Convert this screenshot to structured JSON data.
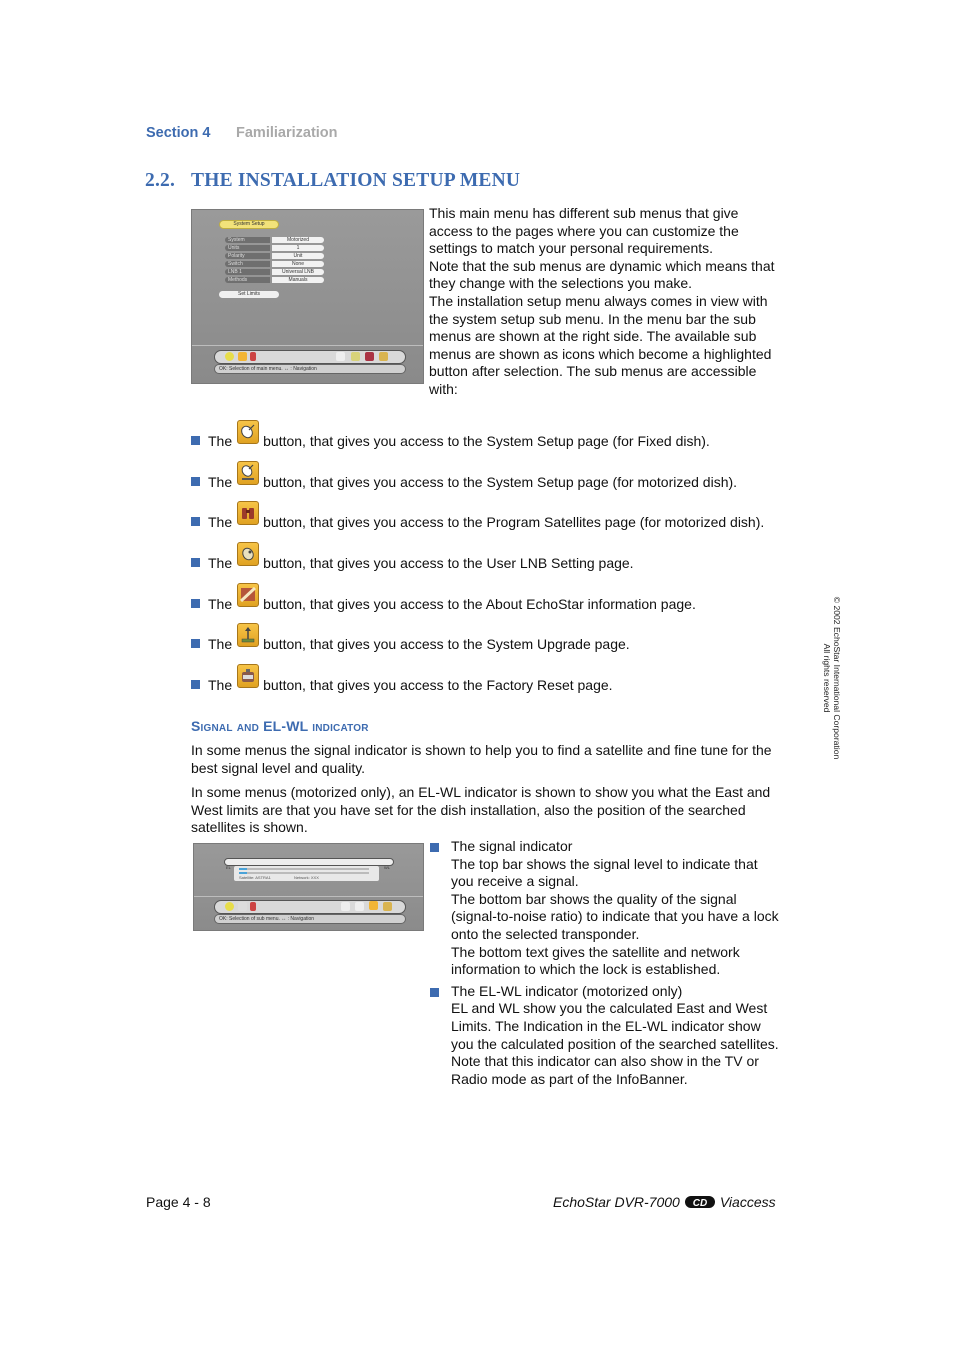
{
  "header": {
    "section_label": "Section 4",
    "section_name": "Familiarization"
  },
  "heading": {
    "number": "2.2.",
    "title": "THE INSTALLATION SETUP MENU"
  },
  "screenshot_setup": {
    "title": "System Setup",
    "rows": [
      {
        "label": "System",
        "value": "Motorized"
      },
      {
        "label": "Units",
        "value": "1"
      },
      {
        "label": "Polarity",
        "value": "Unit"
      },
      {
        "label": "Switch",
        "value": "None"
      },
      {
        "label": "LNB 1",
        "value": "Universal LNB"
      },
      {
        "label": "Methods",
        "value": "Manuals"
      }
    ],
    "button": "Set Limits",
    "status": "OK: Selection of main menu. ↔ : Navigation"
  },
  "intro": [
    "This main menu has different sub menus that give access to the pages where you can customize the settings to match your personal requirements.",
    "Note that the sub menus are dynamic which means that they change with the selections you make.",
    "The installation setup menu always comes in view with the system setup sub menu. In the menu bar the sub menus are shown at the right side. The available sub menus are shown as icons which become a highlighted button after selection. The sub menus are accessible with:"
  ],
  "bullets": [
    {
      "prefix": "The",
      "icon": "satellite-dish-fixed-icon",
      "text": "button, that gives you access to the System Setup page (for Fixed dish)."
    },
    {
      "prefix": "The",
      "icon": "satellite-dish-motorized-icon",
      "text": "button, that gives you access to the System Setup page (for motorized dish)."
    },
    {
      "prefix": "The",
      "icon": "binoculars-icon",
      "text": "button, that gives you access to the Program Satellites page (for motorized dish)."
    },
    {
      "prefix": "The",
      "icon": "lnb-dish-icon",
      "text": "button, that gives you access to the User LNB Setting page."
    },
    {
      "prefix": "The",
      "icon": "about-echostar-icon",
      "text": "button, that gives you access to the About EchoStar information page."
    },
    {
      "prefix": "The",
      "icon": "system-upgrade-icon",
      "text": "button, that gives you access to the System Upgrade page."
    },
    {
      "prefix": "The",
      "icon": "factory-reset-icon",
      "text": "button, that gives you access to the Factory Reset page."
    }
  ],
  "signal_section": {
    "title_parts": [
      "Signal and ",
      "EL-WL",
      " indicator"
    ],
    "para1": "In some menus the signal indicator is shown to help you to find a satellite and fine tune for the best signal level and quality.",
    "para2": "In some menus (motorized only), an EL-WL indicator is shown to show you what the East and West limits are that you have set for the dish installation, also the position of the searched satellites is shown.",
    "screenshot": {
      "el_label": "EL",
      "wl_label": "WL",
      "satellite_text": "Satellite: ASTRA1",
      "network_text": "Network: XXX",
      "status": "OK: Selection of sub menu. ↔ : Navigation"
    },
    "items": [
      {
        "title": "The signal indicator",
        "lines": [
          "The top bar shows the signal level to indicate that you receive a signal.",
          "The bottom bar shows the quality of the signal (signal-to-noise ratio) to indicate that you have a lock onto the selected transponder.",
          "The bottom text gives the satellite and network information to which the lock is established."
        ]
      },
      {
        "title": "The EL-WL indicator (motorized only)",
        "lines": [
          "EL and WL show you the calculated East and West Limits. The Indication in the EL-WL indicator show you the calculated position of the searched satellites. Note that this indicator can also show in the TV or Radio mode as part of the InfoBanner."
        ]
      }
    ]
  },
  "sidebar_note": {
    "line1": "© 2002 EchoStar International Corporation",
    "line2": "All rights reserved"
  },
  "footer": {
    "page": "Page 4 - 8",
    "product": "EchoStar DVR-7000",
    "brand": "Viaccess"
  },
  "colors": {
    "accent": "#3d6bb0",
    "muted": "#a9a9a9",
    "icon_gold": "#f2b535"
  }
}
